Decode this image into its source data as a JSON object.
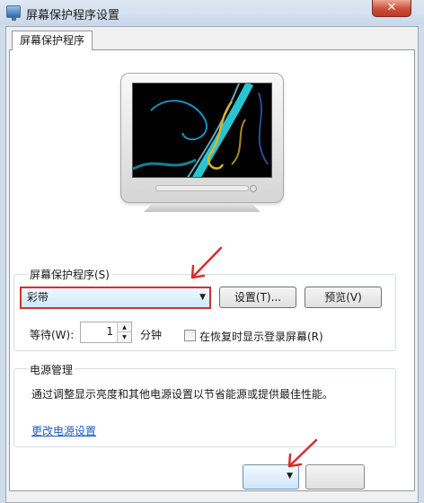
{
  "window": {
    "title": "屏幕保护程序设置",
    "close_symbol": "✕",
    "icon": "display-settings-icon"
  },
  "tab": {
    "label": "屏幕保护程序"
  },
  "screensaver": {
    "group_label": "屏幕保护程序(S)",
    "selected": "彩带",
    "dropdown_arrow": "▼",
    "settings_button": "设置(T)...",
    "preview_button": "预览(V)",
    "wait_label": "等待(W):",
    "wait_value": "1",
    "wait_unit": "分钟",
    "resume_label": "在恢复时显示登录屏幕(R)",
    "resume_checked": false
  },
  "power": {
    "group_label": "电源管理",
    "description": "通过调整显示亮度和其他电源设置以节省能源或提供最佳性能。",
    "link": "更改电源设置"
  },
  "footer": {
    "dropdown_arrow": "▼"
  },
  "colors": {
    "annotation_red": "#d62f2f",
    "link_blue": "#1c5dbf",
    "ribbon_cyan": "#2fd9e8",
    "ribbon_yellow": "#d9b62a"
  }
}
